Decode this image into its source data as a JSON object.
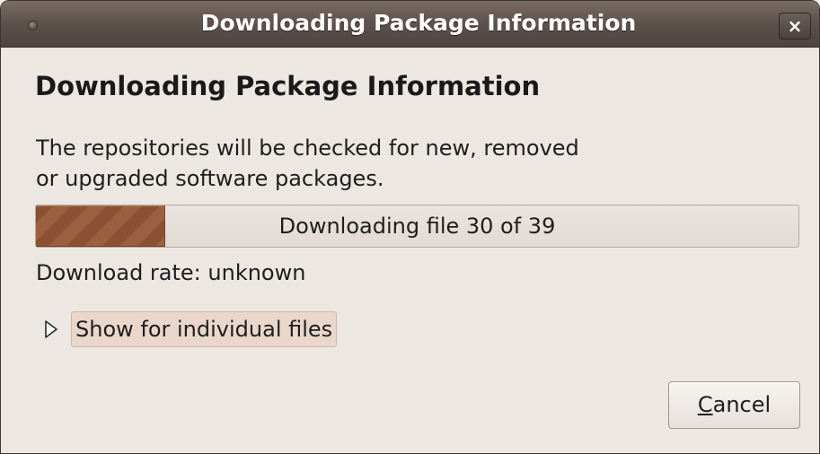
{
  "window": {
    "title": "Downloading Package Information",
    "close_label": "×"
  },
  "dialog": {
    "heading": "Downloading Package Information",
    "description_line1": "The repositories will be checked for new, removed",
    "description_line2": "or upgraded software packages.",
    "progress": {
      "text": "Downloading file 30 of 39",
      "fraction": 0.17
    },
    "download_rate": "Download rate: unknown",
    "expander": {
      "label": "Show for individual files",
      "expanded": false,
      "icon": "triangle-right-icon"
    },
    "cancel": {
      "mnemonic": "C",
      "rest": "ancel"
    }
  },
  "colors": {
    "titlebar": "#5f534d",
    "background": "#ede7e1",
    "progress_fill": "#8a5132"
  }
}
